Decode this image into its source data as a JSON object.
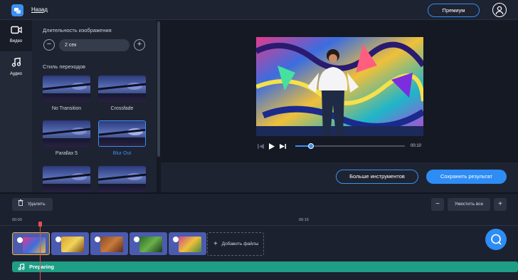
{
  "header": {
    "back_label": "Назад",
    "premium_label": "Премиум"
  },
  "rail": {
    "items": [
      {
        "label": "Видео",
        "icon": "video-camera-icon",
        "active": true
      },
      {
        "label": "Аудио",
        "icon": "music-note-icon",
        "active": false
      }
    ]
  },
  "settings": {
    "duration_title": "Длительность изображения",
    "duration_value": "2 сек",
    "decrease_label": "−",
    "increase_label": "+",
    "transitions_title": "Стиль переходов",
    "transitions": [
      {
        "label": "No Transition",
        "selected": false
      },
      {
        "label": "Crossfade",
        "selected": false
      },
      {
        "label": "Parallax 5",
        "selected": false
      },
      {
        "label": "Blur Out",
        "selected": true
      },
      {
        "label": "",
        "selected": false
      },
      {
        "label": "",
        "selected": false
      }
    ]
  },
  "player": {
    "time": "00:10",
    "progress": 0.14
  },
  "actions": {
    "more_tools": "Больше инструментов",
    "save_result": "Сохранить результат"
  },
  "timeline": {
    "delete_label": "Удалить",
    "minus_label": "−",
    "fit_all_label": "Уместить все",
    "plus_label": "+",
    "ticks": [
      "00:00",
      "00:15"
    ],
    "add_files_label": "Добавить файлы",
    "audio_track_label": "Preparing"
  },
  "colors": {
    "accent": "#2e8cf5",
    "audio_track": "#1f9e86",
    "playhead": "#e4504f",
    "clip_selected": "#f0b429"
  }
}
